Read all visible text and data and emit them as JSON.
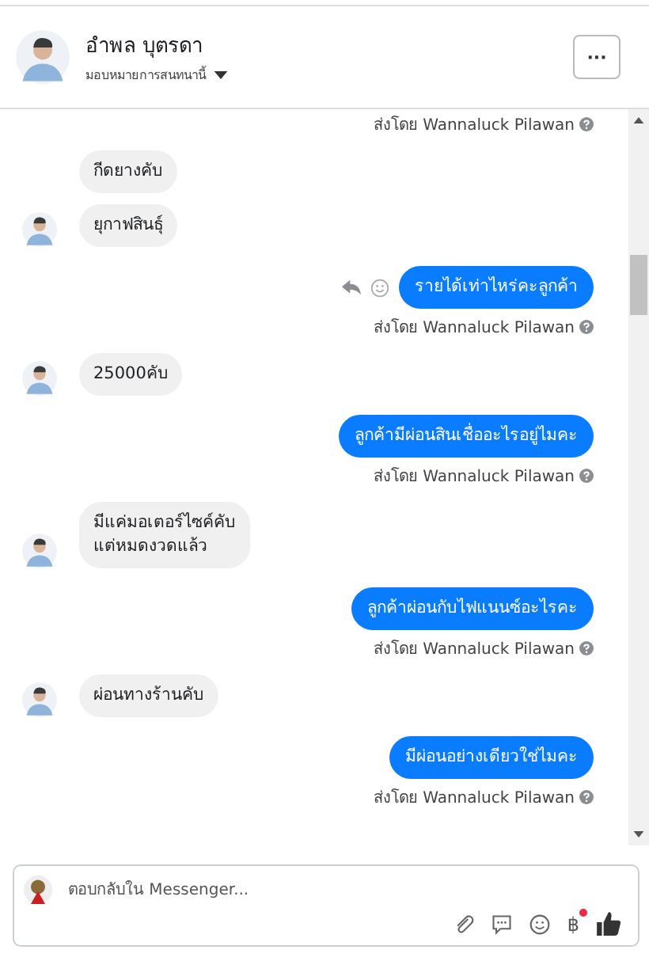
{
  "header": {
    "name": "อำพล บุตรดา",
    "subtitle": "มอบหมายการสนทนานี้",
    "more_button": "···"
  },
  "messages": [
    {
      "kind": "note",
      "text": "ส่งโดย Wannaluck Pilawan"
    },
    {
      "kind": "incoming",
      "text": "กีดยางคับ",
      "show_avatar": false
    },
    {
      "kind": "incoming",
      "text": "ยุกาฟสินธุ์",
      "show_avatar": true
    },
    {
      "kind": "outgoing",
      "text": "รายได้เท่าไหร่คะลูกค้า",
      "hover_actions": true
    },
    {
      "kind": "note",
      "text": "ส่งโดย Wannaluck Pilawan"
    },
    {
      "kind": "incoming",
      "text": "25000คับ",
      "show_avatar": true
    },
    {
      "kind": "outgoing",
      "text": "ลูกค้ามีผ่อนสินเชื่ออะไรอยู่ไมคะ",
      "hover_actions": false
    },
    {
      "kind": "note",
      "text": "ส่งโดย Wannaluck Pilawan"
    },
    {
      "kind": "incoming",
      "text": "มีแค่มอเตอร์ไซค์คับ\nแต่หมดงวดแล้ว",
      "show_avatar": true
    },
    {
      "kind": "outgoing",
      "text": "ลูกค้าผ่อนกับไฟแนนซ์อะไรคะ",
      "hover_actions": false
    },
    {
      "kind": "note",
      "text": "ส่งโดย Wannaluck Pilawan"
    },
    {
      "kind": "incoming",
      "text": "ผ่อนทางร้านคับ",
      "show_avatar": true
    },
    {
      "kind": "outgoing",
      "text": "มีผ่อนอย่างเดียวใช่ไมคะ",
      "hover_actions": false
    },
    {
      "kind": "note",
      "text": "ส่งโดย Wannaluck Pilawan"
    }
  ],
  "composer": {
    "placeholder": "ตอบกลับใน Messenger...",
    "currency_symbol": "฿",
    "notification": true
  }
}
